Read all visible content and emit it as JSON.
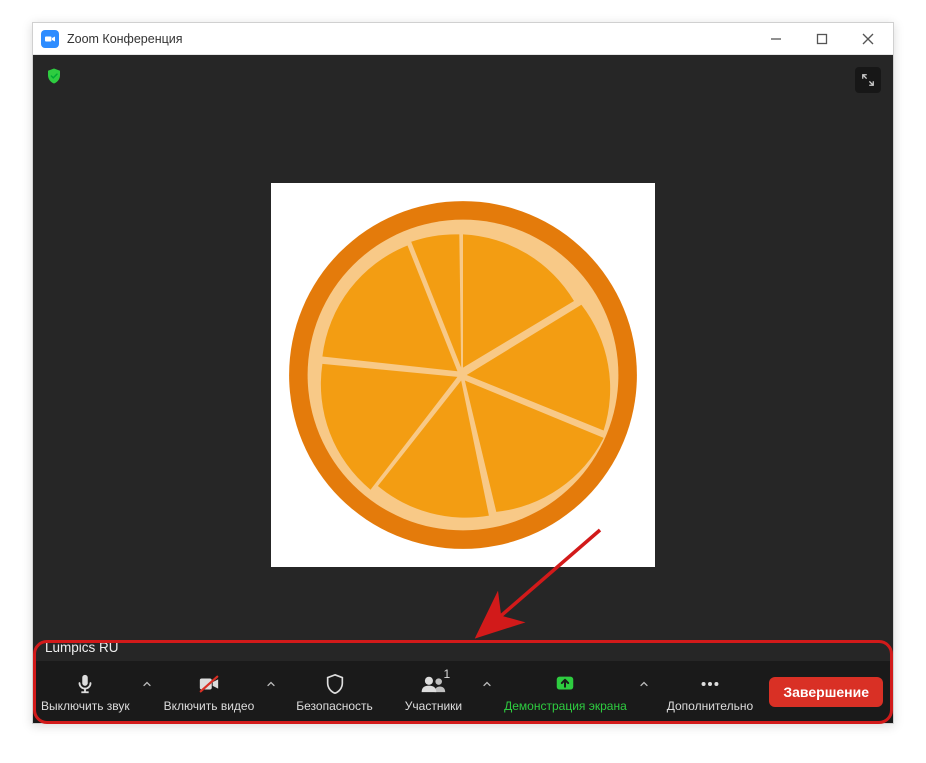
{
  "window": {
    "title": "Zoom Конференция"
  },
  "participant_name": "Lumpics RU",
  "toolbar": {
    "mute": {
      "label": "Выключить звук"
    },
    "video": {
      "label": "Включить видео"
    },
    "security": {
      "label": "Безопасность"
    },
    "participants": {
      "label": "Участники",
      "count": "1"
    },
    "share": {
      "label": "Демонстрация экрана"
    },
    "more": {
      "label": "Дополнительно"
    },
    "end": {
      "label": "Завершение"
    }
  }
}
